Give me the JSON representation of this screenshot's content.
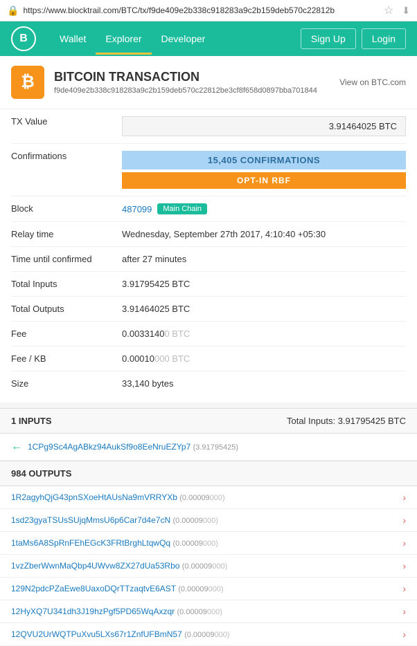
{
  "url": "https://www.blocktrail.com/BTC/tx/f9de409e2b338c918283a9c2b159deb570c22812b",
  "nav": {
    "logo": "B",
    "links": [
      {
        "label": "Wallet",
        "active": false
      },
      {
        "label": "Explorer",
        "active": true
      },
      {
        "label": "Developer",
        "active": false
      }
    ],
    "right_links": [
      {
        "label": "Sign Up"
      },
      {
        "label": "Login"
      }
    ]
  },
  "transaction": {
    "title": "BITCOIN TRANSACTION",
    "view_link": "View on BTC.com",
    "hash": "f9de409e2b338c918283a9c2b159deb570c22812be3cf8f658d0897bba701844",
    "btc_symbol": "₿",
    "fields": {
      "tx_value_label": "TX Value",
      "tx_value": "3.91464025 BTC",
      "confirmations_label": "Confirmations",
      "confirmations": "15,405 CONFIRMATIONS",
      "rbf": "OPT-IN RBF",
      "block_label": "Block",
      "block_number": "487099",
      "block_badge": "Main Chain",
      "relay_label": "Relay time",
      "relay_value": "Wednesday, September 27th 2017, 4:10:40 +05:30",
      "time_label": "Time until confirmed",
      "time_value": "after 27 minutes",
      "total_inputs_label": "Total Inputs",
      "total_inputs_value": "3.91795425 BTC",
      "total_outputs_label": "Total Outputs",
      "total_outputs_value": "3.91464025 BTC",
      "fee_label": "Fee",
      "fee_main": "0.0033140",
      "fee_dim": "0 BTC",
      "fee_kb_label": "Fee / KB",
      "fee_kb_main": "0.00010",
      "fee_kb_dim": "000 BTC",
      "size_label": "Size",
      "size_value": "33,140 bytes"
    }
  },
  "inputs": {
    "header": "1 INPUTS",
    "total": "Total Inputs: 3.91795425 BTC",
    "items": [
      {
        "address": "1CPg9Sc4AgABkz94AukSf9o8EeNruEZYp7",
        "amount": "(3.91795425)"
      }
    ]
  },
  "outputs": {
    "header": "984 OUTPUTS",
    "items": [
      {
        "address": "1R2agyhQjG43pnSXoeHtAUsNa9mVRRYXb",
        "amount": "(0.00009",
        "dim": "000)"
      },
      {
        "address": "1sd23gyaTSUsSUjqMmsU6p6Car7d4e7cN",
        "amount": "(0.00009",
        "dim": "000)"
      },
      {
        "address": "1taMs6A8SpRnFEhEGcK3FRtBrghLtqwQq",
        "amount": "(0.00009",
        "dim": "000)"
      },
      {
        "address": "1vzZberWwnMaQbp4UWvw8ZX27dUa53Rbo",
        "amount": "(0.00009",
        "dim": "000)"
      },
      {
        "address": "129N2pdcPZaEwe8UaxoDQrTTzaqtvE6AST",
        "amount": "(0.00009",
        "dim": "000)"
      },
      {
        "address": "12HyXQ7U341dh3J19hzPgf5PD65WqAxzqr",
        "amount": "(0.00009",
        "dim": "000)"
      },
      {
        "address": "12QVU2UrWQTPuXvu5LXs67r1ZnfUFBmN57",
        "amount": "(0.00009",
        "dim": "000)"
      }
    ]
  }
}
